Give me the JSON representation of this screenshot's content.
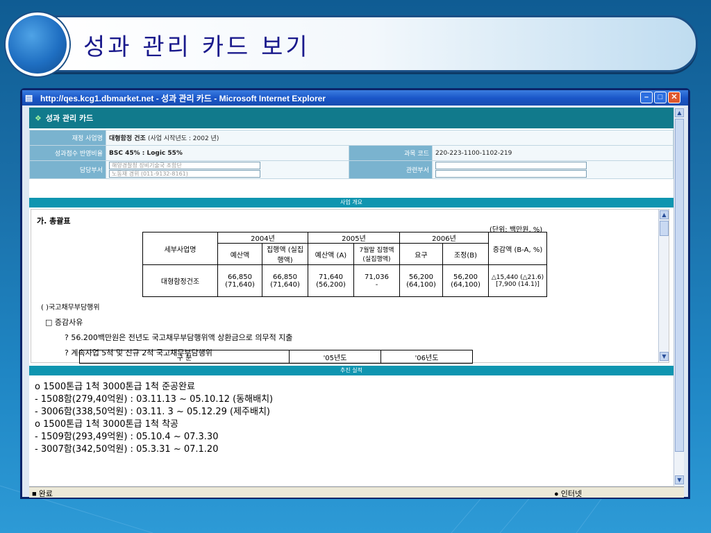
{
  "slide": {
    "title": "성과 관리 카드 보기"
  },
  "window": {
    "title": "http://qes.kcg1.dbmarket.net - 성과 관리 카드 - Microsoft Internet Explorer",
    "status_left": "완료",
    "status_right": "인터넷"
  },
  "page": {
    "header": "성과 관리 카드",
    "info": {
      "project_label": "재정 사업명",
      "project_value": "대형함정 건조",
      "project_note": "(사업 시작년도 : 2002 년)",
      "score_label": "성과점수 반영비율",
      "score_value": "BSC 45% : Logic 55%",
      "code_label": "과목 코드",
      "code_value": "220-223-1100-1102-219",
      "dept_label": "담당부서",
      "dept_input1": "해양경찰청 장비기술국 조함단",
      "dept_input2": "노동재 경위 (011-9132-8161)",
      "related_label": "관련부서"
    },
    "section1": "사업 개요",
    "section2": "추진 실적"
  },
  "overview": {
    "heading": "가. 총괄표",
    "unit": "(단위: 백만원, %)",
    "table": {
      "col_project": "세부사업명",
      "years": [
        "2004년",
        "2005년",
        "2006년"
      ],
      "col_budget_04": "예산액",
      "col_exec_04": "집행액 (실집행액)",
      "col_budget_05": "예산액 (A)",
      "col_exec_05": "7월말 집행액 (실집행액)",
      "col_req_06": "요구",
      "col_adj_06": "조정(B)",
      "col_change": "증감액 (B-A, %)",
      "row_name": "대형함정건조",
      "row": {
        "b04": "66,850",
        "b04s": "(71,640)",
        "e04": "66,850",
        "e04s": "(71,640)",
        "b05": "71,640",
        "b05s": "(56,200)",
        "e05": "71,036",
        "e05s": "-",
        "r06": "56,200",
        "r06s": "(64,100)",
        "a06": "56,200",
        "a06s": "(64,100)",
        "change": "△15,440 (△21.6) [7,900 (14.1)]"
      }
    },
    "note1": "(    )국고채무부담행위",
    "note2": "□ 증감사유",
    "note3": "? 56.200백만원은 전년도 국고채무부담행위액 상환금으로 의무적 지출",
    "note4": "? 계속사업 5척 및 신규 2척 국고채무부담행위",
    "sub_table": [
      "구          분",
      "'05년도",
      "'06년도"
    ]
  },
  "results": [
    "o  1500톤급 1척  3000톤급 1척  준공완료",
    "  - 1508함(279,40억원) : 03.11.13  ~  05.10.12 (동해배치)",
    "  - 3006함(338,50억원) : 03.11. 3  ~  05.12.29 (제주배치)",
    "o  1500톤급 1척  3000톤급 1척  착공",
    "  - 1509함(293,49억원) : 05.10.4  ~  07.3.30",
    "  - 3007함(342,50억원) : 05.3.31  ~  07.1.20"
  ]
}
